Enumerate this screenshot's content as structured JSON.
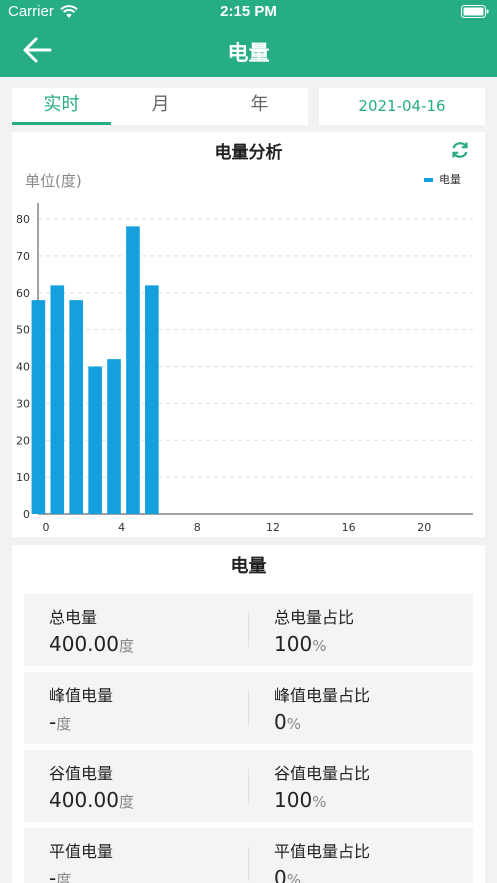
{
  "status_bar": {
    "carrier": "Carrier",
    "time": "2:15 PM"
  },
  "nav": {
    "title": "电量"
  },
  "tabs": [
    {
      "label": "实时",
      "active": true
    },
    {
      "label": "月",
      "active": false
    },
    {
      "label": "年",
      "active": false
    }
  ],
  "date": "2021-04-16",
  "chart": {
    "title": "电量分析",
    "unit_label": "单位(度)",
    "legend_label": "电量"
  },
  "chart_data": {
    "type": "bar",
    "title": "电量分析",
    "ylabel": "单位(度)",
    "xlabel": "",
    "series": [
      {
        "name": "电量",
        "color": "#149fde",
        "x": [
          0,
          1,
          2,
          3,
          4,
          5,
          6
        ],
        "values": [
          58,
          62,
          58,
          40,
          42,
          78,
          62
        ]
      }
    ],
    "x_ticks": [
      "0",
      "4",
      "8",
      "12",
      "16",
      "20"
    ],
    "y_ticks": [
      "0",
      "10",
      "20",
      "30",
      "40",
      "50",
      "60",
      "70",
      "80"
    ],
    "xlim": [
      0,
      23
    ],
    "ylim": [
      0,
      80
    ],
    "grid": true,
    "legend_position": "top-right"
  },
  "stats": {
    "title": "电量",
    "rows": [
      {
        "left_label": "总电量",
        "left_value": "400.00",
        "left_unit": "度",
        "right_label": "总电量占比",
        "right_value": "100",
        "right_unit": "%"
      },
      {
        "left_label": "峰值电量",
        "left_value": "-",
        "left_unit": "度",
        "right_label": "峰值电量占比",
        "right_value": "0",
        "right_unit": "%"
      },
      {
        "left_label": "谷值电量",
        "left_value": "400.00",
        "left_unit": "度",
        "right_label": "谷值电量占比",
        "right_value": "100",
        "right_unit": "%"
      },
      {
        "left_label": "平值电量",
        "left_value": "-",
        "left_unit": "度",
        "right_label": "平值电量占比",
        "right_value": "0",
        "right_unit": "%"
      }
    ]
  },
  "colors": {
    "brand": "#27ad84",
    "bar": "#149fde"
  }
}
